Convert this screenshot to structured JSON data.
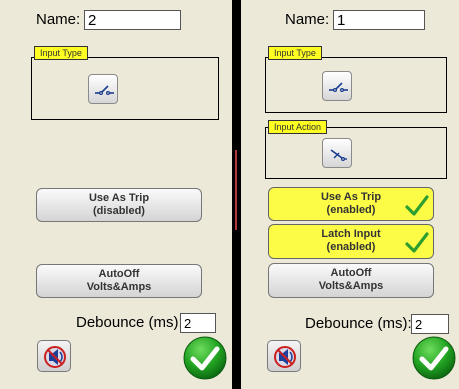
{
  "left": {
    "name_label": "Name:",
    "name_value": "2",
    "input_type_label": "Input Type",
    "input_type_icon": "switch-open-icon",
    "trip_button": {
      "line1": "Use As Trip",
      "line2": "(disabled)"
    },
    "autooff_button": {
      "line1": "AutoOff",
      "line2": "Volts&Amps"
    },
    "debounce_label": "Debounce (ms):",
    "debounce_value": "2"
  },
  "right": {
    "name_label": "Name:",
    "name_value": "1",
    "input_type_label": "Input Type",
    "input_type_icon": "switch-open-icon",
    "input_action_label": "Input Action",
    "input_action_icon": "switch-action-icon",
    "trip_button": {
      "line1": "Use As Trip",
      "line2": "(enabled)",
      "checked": true
    },
    "latch_button": {
      "line1": "Latch Input",
      "line2": "(enabled)",
      "checked": true
    },
    "autooff_button": {
      "line1": "AutoOff",
      "line2": "Volts&Amps"
    },
    "debounce_label": "Debounce (ms):",
    "debounce_value": "2"
  },
  "colors": {
    "panel_bg": "#ece9d8",
    "highlight": "#fcfc47",
    "check_green": "#2e9e2e",
    "ok_green": "#1f9d1f"
  }
}
